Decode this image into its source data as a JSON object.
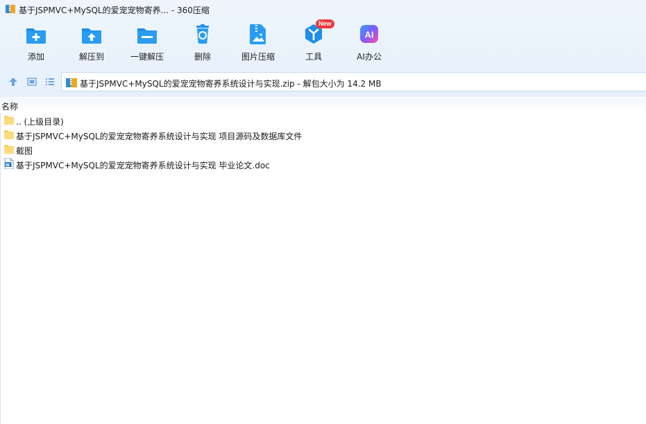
{
  "window": {
    "title": "基于JSPMVC+MySQL的爱宠宠物寄养... - 360压缩"
  },
  "toolbar": {
    "items": [
      {
        "label": "添加",
        "icon": "add-icon"
      },
      {
        "label": "解压到",
        "icon": "extract-to-icon"
      },
      {
        "label": "一键解压",
        "icon": "one-click-extract-icon"
      },
      {
        "label": "删除",
        "icon": "delete-icon"
      },
      {
        "label": "图片压缩",
        "icon": "image-compress-icon"
      },
      {
        "label": "工具",
        "icon": "tools-icon",
        "badge": "New"
      },
      {
        "label": "AI办公",
        "icon": "ai-office-icon",
        "glyph": "AI"
      }
    ]
  },
  "address": {
    "path": "基于JSPMVC+MySQL的爱宠宠物寄养系统设计与实现.zip - 解包大小为 14.2 MB"
  },
  "list": {
    "header_name": "名称",
    "files": [
      {
        "name": ".. (上级目录)",
        "type": "folder"
      },
      {
        "name": "基于JSPMVC+MySQL的爱宠宠物寄养系统设计与实现 项目源码及数据库文件",
        "type": "folder"
      },
      {
        "name": "截图",
        "type": "folder"
      },
      {
        "name": "基于JSPMVC+MySQL的爱宠宠物寄养系统设计与实现 毕业论文.doc",
        "type": "doc"
      }
    ]
  },
  "colors": {
    "accent": "#1e8ee8",
    "badge": "#f2373b"
  }
}
